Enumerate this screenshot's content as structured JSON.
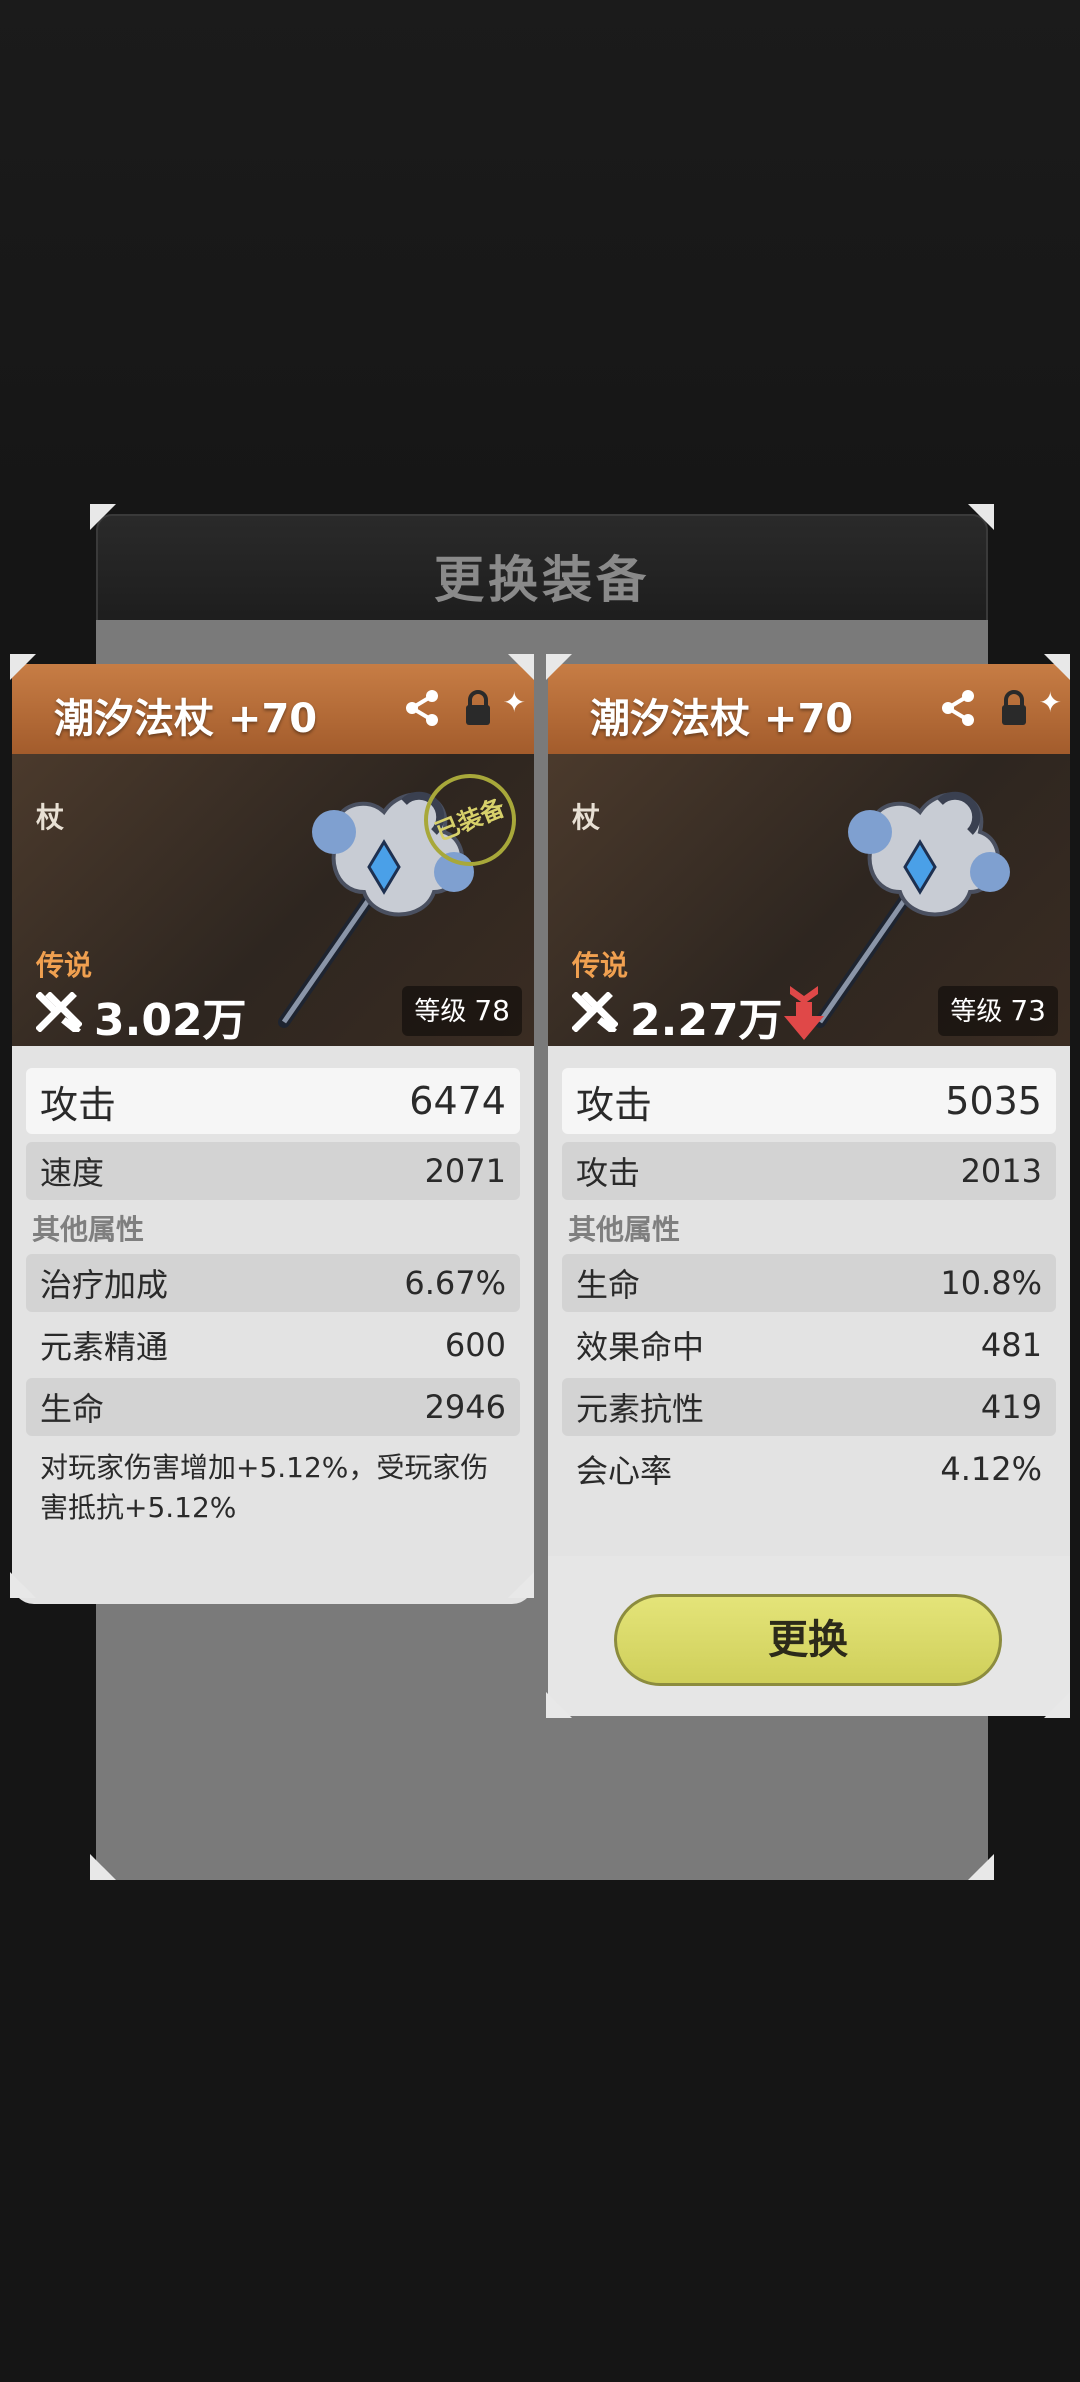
{
  "dialog": {
    "title": "更换装备"
  },
  "cards": [
    {
      "name": "潮汐法杖 +70",
      "type": "杖",
      "rarity": "传说",
      "power": "3.02万",
      "level_label": "等级",
      "level": "78",
      "badge": "已装备",
      "main_stat": {
        "label": "攻击",
        "value": "6474"
      },
      "sub_stat": {
        "label": "速度",
        "value": "2071"
      },
      "other_label": "其他属性",
      "others": [
        {
          "label": "治疗加成",
          "value": "6.67%"
        },
        {
          "label": "元素精通",
          "value": "600"
        },
        {
          "label": "生命",
          "value": "2946"
        }
      ],
      "extra": "对玩家伤害增加+5.12%，受玩家伤害抵抗+5.12%"
    },
    {
      "name": "潮汐法杖 +70",
      "type": "杖",
      "rarity": "传说",
      "power": "2.27万",
      "level_label": "等级",
      "level": "73",
      "main_stat": {
        "label": "攻击",
        "value": "5035"
      },
      "sub_stat": {
        "label": "攻击",
        "value": "2013"
      },
      "other_label": "其他属性",
      "others": [
        {
          "label": "生命",
          "value": "10.8%"
        },
        {
          "label": "效果命中",
          "value": "481"
        },
        {
          "label": "元素抗性",
          "value": "419"
        },
        {
          "label": "会心率",
          "value": "4.12%"
        }
      ],
      "button": "更换"
    }
  ],
  "colors": {
    "card_header": "#b86a36",
    "rarity": "#f0a050",
    "button": "#dada68",
    "down_arrow": "#e04848"
  },
  "icons": [
    "share-icon",
    "lock-icon",
    "power-icon",
    "down-arrow-icon"
  ]
}
